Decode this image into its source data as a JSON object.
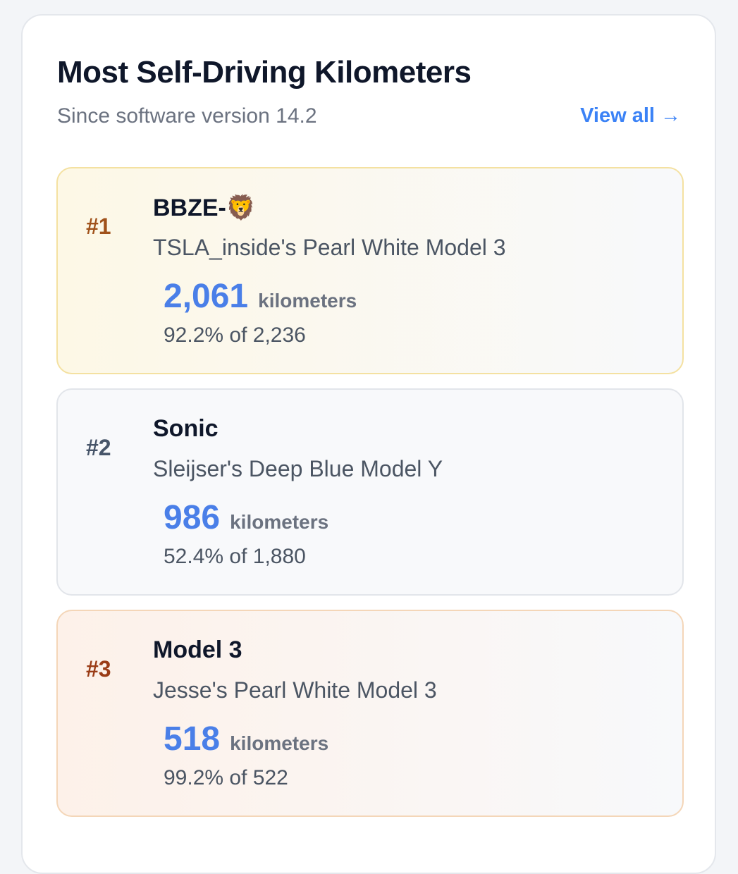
{
  "header": {
    "title": "Most Self-Driving Kilometers",
    "subtitle": "Since software version 14.2",
    "view_all": "View all →"
  },
  "entries": [
    {
      "rank": "#1",
      "name": "BBZE-🦁",
      "vehicle": "TSLA_inside's Pearl White Model 3",
      "kilometers": "2,061",
      "unit": "kilometers",
      "percent_text": "92.2% of 2,236",
      "rank_color": "#a0521b"
    },
    {
      "rank": "#2",
      "name": "Sonic",
      "vehicle": "Sleijser's Deep Blue Model Y",
      "kilometers": "986",
      "unit": "kilometers",
      "percent_text": "52.4% of 1,880",
      "rank_color": "#475569"
    },
    {
      "rank": "#3",
      "name": "Model 3",
      "vehicle": "Jesse's Pearl White Model 3",
      "kilometers": "518",
      "unit": "kilometers",
      "percent_text": "99.2% of 522",
      "rank_color": "#9a3c16"
    }
  ],
  "colors": {
    "accent": "#4a7fe8",
    "link": "#3b82f6",
    "gold_border": "#f4e1a1",
    "bronze_border": "#f4d6b8"
  }
}
